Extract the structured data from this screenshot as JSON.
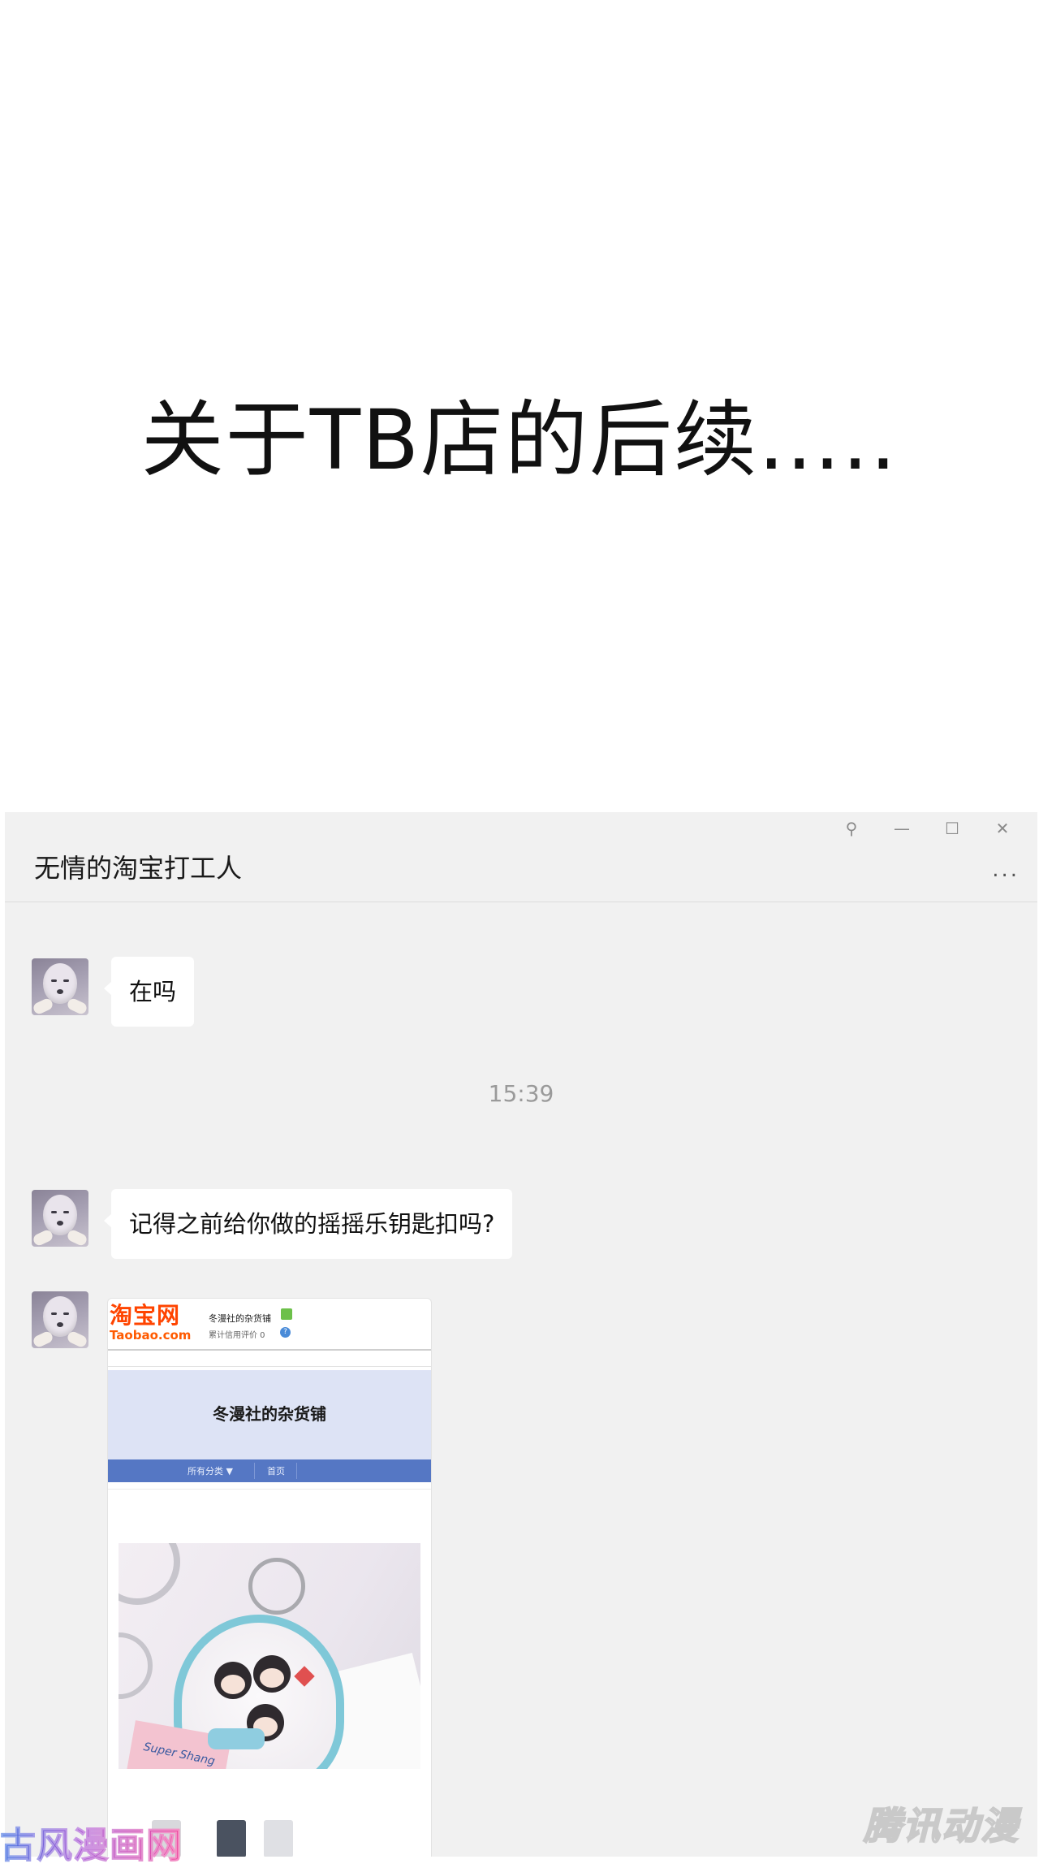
{
  "headline": "关于TB店的后续.....",
  "window": {
    "controls": {
      "pin": "⚲",
      "minimize": "—",
      "maximize": "☐",
      "close": "✕"
    },
    "title": "无情的淘宝打工人",
    "more": "..."
  },
  "messages": [
    {
      "text": "在吗"
    },
    {
      "text": "记得之前给你做的摇摇乐钥匙扣吗?"
    }
  ],
  "timestamp": "15:39",
  "shop_card": {
    "logo_cn": "淘宝网",
    "logo_en": "Taobao.com",
    "shop_name_small": "冬漫社的杂货铺",
    "credit": "累计信用评价 0",
    "banner_title": "冬漫社的杂货铺",
    "nav": {
      "all_categories": "所有分类 ▼",
      "home": "首页"
    },
    "product_label": "Super Shang"
  },
  "watermarks": {
    "left": "古风漫画网",
    "right": "腾讯动漫"
  },
  "colors": {
    "chat_bg": "#f1f1f1",
    "bubble_bg": "#ffffff",
    "taobao_orange": "#ff4400",
    "shop_nav": "#5577c4",
    "shop_banner": "#dde3f5"
  },
  "icons": [
    "pin-icon",
    "minimize-icon",
    "maximize-icon",
    "close-icon",
    "more-icon",
    "avatar",
    "wangwang-icon",
    "info-icon"
  ]
}
